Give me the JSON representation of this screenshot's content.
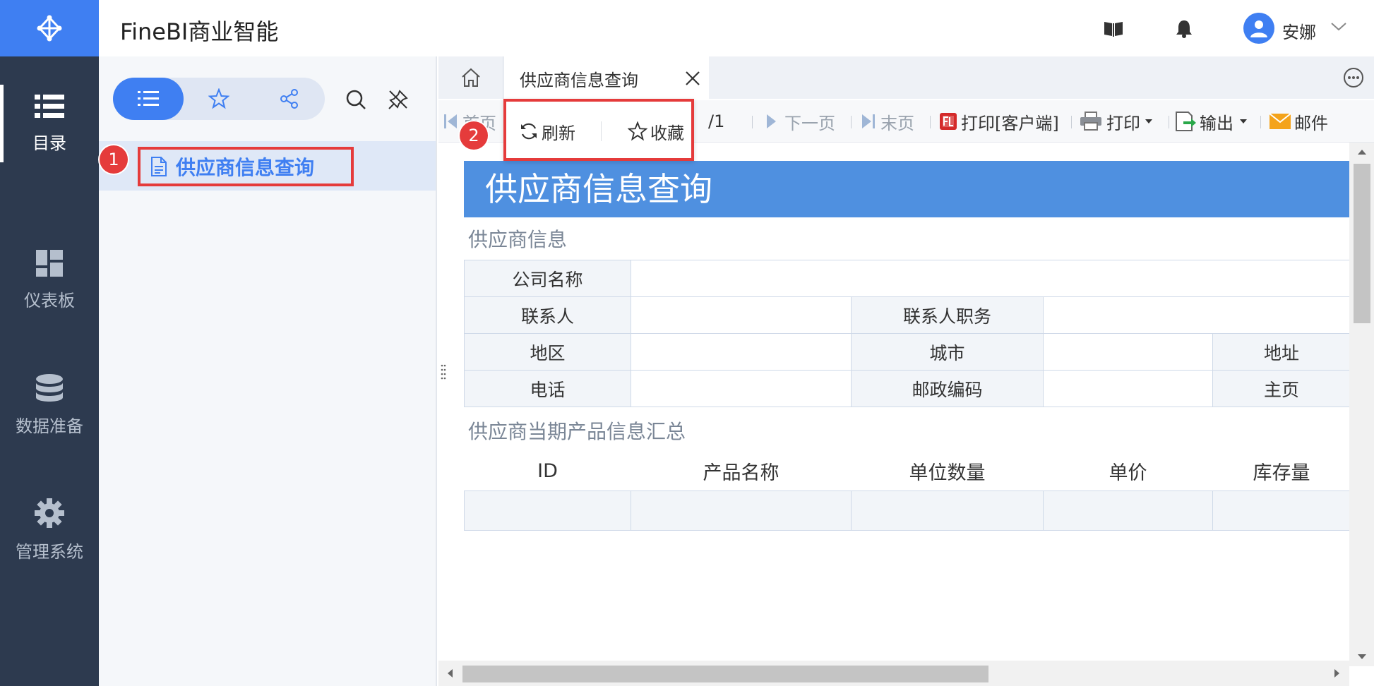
{
  "app": {
    "title": "FineBI商业智能"
  },
  "nav": {
    "items": [
      {
        "label": "目录",
        "icon": "list-icon",
        "active": true
      },
      {
        "label": "仪表板",
        "icon": "dashboard-icon",
        "active": false
      },
      {
        "label": "数据准备",
        "icon": "database-icon",
        "active": false
      },
      {
        "label": "管理系统",
        "icon": "gear-icon",
        "active": false
      }
    ]
  },
  "header": {
    "icons": [
      "book-icon",
      "bell-icon"
    ],
    "user": {
      "name": "安娜"
    }
  },
  "directory": {
    "tabs": [
      "list-icon",
      "star-icon",
      "share-icon"
    ],
    "tools": [
      "search-icon",
      "pin-icon"
    ],
    "item": {
      "label": "供应商信息查询",
      "icon": "document-icon"
    }
  },
  "badges": {
    "one": "1",
    "two": "2"
  },
  "tabs": {
    "home_icon": "home-icon",
    "active": {
      "title": "供应商信息查询"
    }
  },
  "toolbar": {
    "first": "首页",
    "page_total": "/1",
    "next": "下一页",
    "last": "末页",
    "print_client": "打印[客户端]",
    "print": "打印",
    "export": "输出",
    "mail": "邮件"
  },
  "popup": {
    "refresh": "刷新",
    "favorite": "收藏"
  },
  "report": {
    "title": "供应商信息查询",
    "section1": "供应商信息",
    "fields": {
      "company": "公司名称",
      "contact": "联系人",
      "contact_title": "联系人职务",
      "region": "地区",
      "city": "城市",
      "address": "地址",
      "phone": "电话",
      "postcode": "邮政编码",
      "homepage": "主页"
    },
    "section2": "供应商当期产品信息汇总",
    "columns": [
      "ID",
      "产品名称",
      "单位数量",
      "单价",
      "库存量"
    ]
  },
  "colors": {
    "accent": "#3f7ff2",
    "nav_bg": "#2d3a4f",
    "highlight": "#e53b3b",
    "report_header": "#4f90e0"
  }
}
